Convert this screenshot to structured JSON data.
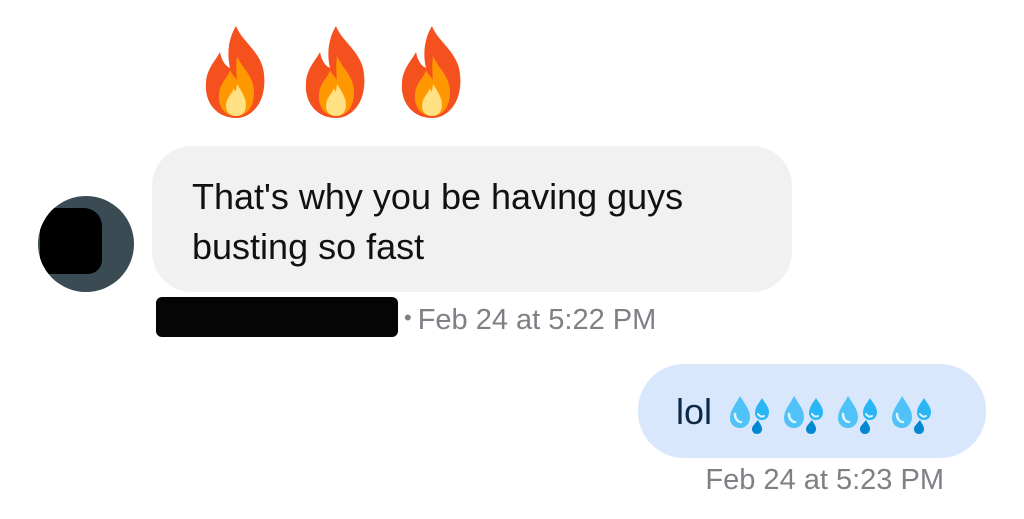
{
  "reactions": {
    "icons": [
      "fire-icon",
      "fire-icon",
      "fire-icon"
    ]
  },
  "incoming": {
    "text": "That's why you be having guys\nbusting so fast",
    "meta": "Feb 24 at 5:22 PM",
    "separator": "•"
  },
  "outgoing": {
    "text": "lol",
    "emoji_icons": [
      "sweat-droplets-icon",
      "sweat-droplets-icon",
      "sweat-droplets-icon",
      "sweat-droplets-icon"
    ],
    "meta": "Feb 24 at 5:23 PM"
  },
  "colors": {
    "incoming_bubble": "#f1f1f2",
    "outgoing_bubble": "#d9e7fd",
    "meta_text": "#7f7f85",
    "avatar": "#3a4b54"
  }
}
